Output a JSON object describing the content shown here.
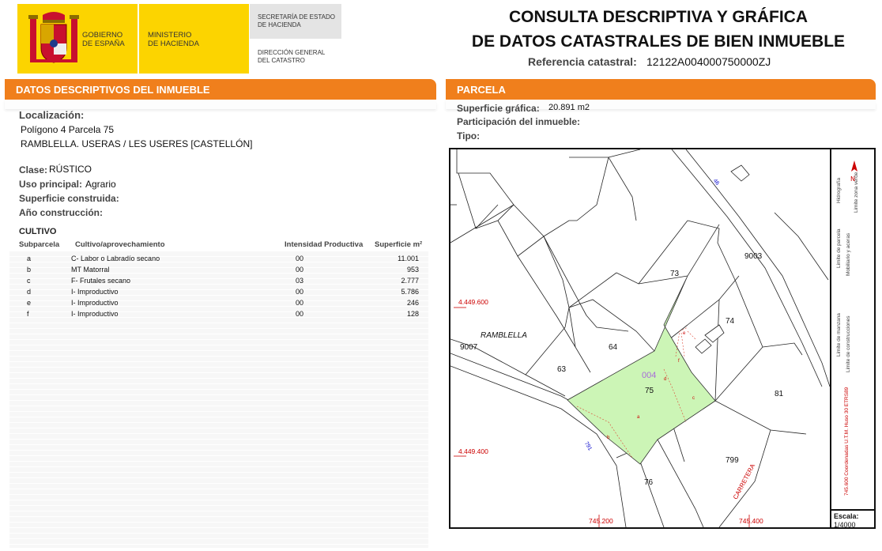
{
  "header": {
    "gov_line1": "GOBIERNO",
    "gov_line2": "DE ESPAÑA",
    "min_line1": "MINISTERIO",
    "min_line2": "DE HACIENDA",
    "secretaria_line1": "SECRETARÍA DE ESTADO",
    "secretaria_line2": "DE HACIENDA",
    "direccion_line1": "DIRECCIÓN GENERAL",
    "direccion_line2": "DEL CATASTRO",
    "title_line1": "CONSULTA DESCRIPTIVA Y GRÁFICA",
    "title_line2": "DE DATOS CATASTRALES DE BIEN INMUEBLE",
    "ref_label": "Referencia catastral:",
    "ref_value": "12122A004000750000ZJ",
    "brand_color": "#fcd400",
    "accent_color": "#f07f1c"
  },
  "datos": {
    "section_title": "DATOS DESCRIPTIVOS DEL INMUEBLE",
    "localizacion_label": "Localización:",
    "localizacion_line1": "Polígono 4 Parcela 75",
    "localizacion_line2": "RAMBLELLA. USERAS / LES USERES [CASTELLÓN]",
    "clase_label": "Clase:",
    "clase_value": "RÚSTICO",
    "uso_label": "Uso principal:",
    "uso_value": "Agrario",
    "superficie_label": "Superficie construida:",
    "anio_label": "Año construcción:"
  },
  "cultivo": {
    "title": "CULTIVO",
    "headers": {
      "subparcela": "Subparcela",
      "cultivo": "Cultivo/aprovechamiento",
      "intensidad": "Intensidad Productiva",
      "superficie": "Superficie m²"
    },
    "rows": [
      {
        "sub": "a",
        "cultivo": "C- Labor o Labradío secano",
        "intensidad": "00",
        "superficie": "11.001"
      },
      {
        "sub": "b",
        "cultivo": "MT Matorral",
        "intensidad": "00",
        "superficie": "953"
      },
      {
        "sub": "c",
        "cultivo": "F- Frutales secano",
        "intensidad": "03",
        "superficie": "2.777"
      },
      {
        "sub": "d",
        "cultivo": "I- Improductivo",
        "intensidad": "00",
        "superficie": "5.786"
      },
      {
        "sub": "e",
        "cultivo": "I- Improductivo",
        "intensidad": "00",
        "superficie": "246"
      },
      {
        "sub": "f",
        "cultivo": "I- Improductivo",
        "intensidad": "00",
        "superficie": "128"
      }
    ]
  },
  "parcela": {
    "section_title": "PARCELA",
    "sup_grafica_label": "Superficie gráfica:",
    "sup_grafica_value": "20.891 m2",
    "participacion_label": "Participación del inmueble:",
    "tipo_label": "Tipo:"
  },
  "map": {
    "parcel_labels": [
      "73",
      "74",
      "64",
      "63",
      "75",
      "81",
      "799",
      "76",
      "9003",
      "9007"
    ],
    "poligono_label": "004",
    "paraje_label": "RAMBLELLA",
    "road_label": "CARRETERA",
    "coord_y1": "4.449.600",
    "coord_y2": "4.449.400",
    "coord_x1": "745.200",
    "coord_x2": "745.400",
    "road_num_top": "46",
    "road_num_bottom": "791",
    "sub_a": "a",
    "sub_b": "b",
    "sub_c": "c",
    "sub_d": "d",
    "sub_e": "e",
    "sub_f": "f",
    "legend": {
      "hidrografia": "Hidrografía",
      "limite_zona_verde": "Limite zona verde",
      "limite_parcela": "Limite de parcela",
      "mobiliario": "Mobiliario y aceras",
      "limite_manzana": "Limite de manzana",
      "limite_construcciones": "Limite de construcciones",
      "coordenadas": "745.600 Coordenadas U.T.M. Huso 30 ETRS89"
    },
    "escala_label": "Escala:",
    "escala_value": "1/4000",
    "parcel_fill": "#ccf5b6"
  }
}
